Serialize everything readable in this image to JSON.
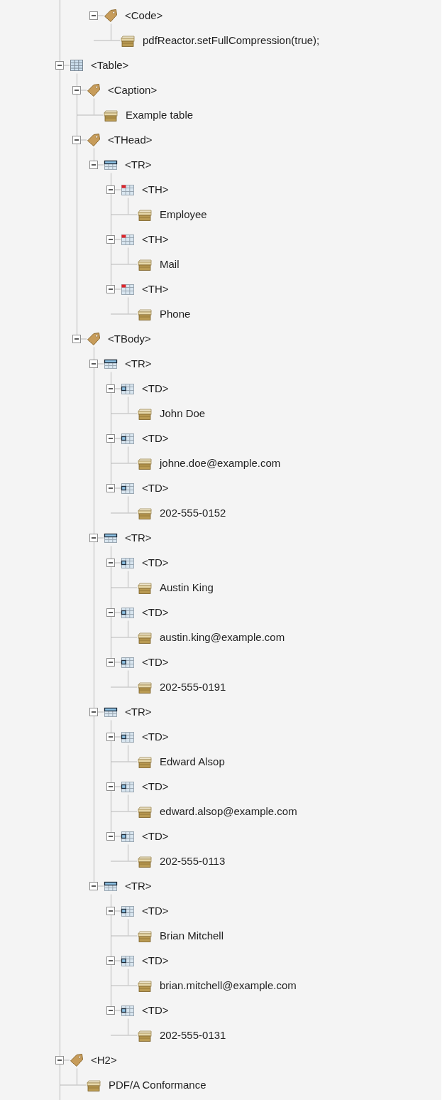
{
  "tree_top_fragment": [
    {
      "label": "<Code>",
      "kind": "tag",
      "expanded": true,
      "children": [
        {
          "label": "pdfReactor.setFullCompression(true);",
          "kind": "content"
        }
      ]
    }
  ],
  "tree": [
    {
      "label": "<Table>",
      "kind": "table",
      "expanded": true,
      "children": [
        {
          "label": "<Caption>",
          "kind": "tag",
          "expanded": true,
          "children": [
            {
              "label": "Example table",
              "kind": "content"
            }
          ]
        },
        {
          "label": "<THead>",
          "kind": "tag",
          "expanded": true,
          "children": [
            {
              "label": "<TR>",
              "kind": "row",
              "expanded": true,
              "children": [
                {
                  "label": "<TH>",
                  "kind": "header_cell",
                  "expanded": true,
                  "children": [
                    {
                      "label": "Employee",
                      "kind": "content"
                    }
                  ]
                },
                {
                  "label": "<TH>",
                  "kind": "header_cell",
                  "expanded": true,
                  "children": [
                    {
                      "label": "Mail",
                      "kind": "content"
                    }
                  ]
                },
                {
                  "label": "<TH>",
                  "kind": "header_cell",
                  "expanded": true,
                  "children": [
                    {
                      "label": "Phone",
                      "kind": "content"
                    }
                  ]
                }
              ]
            }
          ]
        },
        {
          "label": "<TBody>",
          "kind": "tag",
          "expanded": true,
          "children": [
            {
              "label": "<TR>",
              "kind": "row",
              "expanded": true,
              "children": [
                {
                  "label": "<TD>",
                  "kind": "data_cell",
                  "expanded": true,
                  "children": [
                    {
                      "label": "John Doe",
                      "kind": "content"
                    }
                  ]
                },
                {
                  "label": "<TD>",
                  "kind": "data_cell",
                  "expanded": true,
                  "children": [
                    {
                      "label": "johne.doe@example.com",
                      "kind": "content"
                    }
                  ]
                },
                {
                  "label": "<TD>",
                  "kind": "data_cell",
                  "expanded": true,
                  "children": [
                    {
                      "label": "202-555-0152",
                      "kind": "content"
                    }
                  ]
                }
              ]
            },
            {
              "label": "<TR>",
              "kind": "row",
              "expanded": true,
              "children": [
                {
                  "label": "<TD>",
                  "kind": "data_cell",
                  "expanded": true,
                  "children": [
                    {
                      "label": "Austin King",
                      "kind": "content"
                    }
                  ]
                },
                {
                  "label": "<TD>",
                  "kind": "data_cell",
                  "expanded": true,
                  "children": [
                    {
                      "label": "austin.king@example.com",
                      "kind": "content"
                    }
                  ]
                },
                {
                  "label": "<TD>",
                  "kind": "data_cell",
                  "expanded": true,
                  "children": [
                    {
                      "label": "202-555-0191",
                      "kind": "content"
                    }
                  ]
                }
              ]
            },
            {
              "label": "<TR>",
              "kind": "row",
              "expanded": true,
              "children": [
                {
                  "label": "<TD>",
                  "kind": "data_cell",
                  "expanded": true,
                  "children": [
                    {
                      "label": "Edward Alsop",
                      "kind": "content"
                    }
                  ]
                },
                {
                  "label": "<TD>",
                  "kind": "data_cell",
                  "expanded": true,
                  "children": [
                    {
                      "label": "edward.alsop@example.com",
                      "kind": "content"
                    }
                  ]
                },
                {
                  "label": "<TD>",
                  "kind": "data_cell",
                  "expanded": true,
                  "children": [
                    {
                      "label": "202-555-0113",
                      "kind": "content"
                    }
                  ]
                }
              ]
            },
            {
              "label": "<TR>",
              "kind": "row",
              "expanded": true,
              "children": [
                {
                  "label": "<TD>",
                  "kind": "data_cell",
                  "expanded": true,
                  "children": [
                    {
                      "label": "Brian Mitchell",
                      "kind": "content"
                    }
                  ]
                },
                {
                  "label": "<TD>",
                  "kind": "data_cell",
                  "expanded": true,
                  "children": [
                    {
                      "label": "brian.mitchell@example.com",
                      "kind": "content"
                    }
                  ]
                },
                {
                  "label": "<TD>",
                  "kind": "data_cell",
                  "expanded": true,
                  "children": [
                    {
                      "label": "202-555-0131",
                      "kind": "content"
                    }
                  ]
                }
              ]
            }
          ]
        }
      ]
    },
    {
      "label": "<H2>",
      "kind": "tag",
      "expanded": true,
      "children": [
        {
          "label": "PDF/A Conformance",
          "kind": "content"
        }
      ]
    }
  ]
}
